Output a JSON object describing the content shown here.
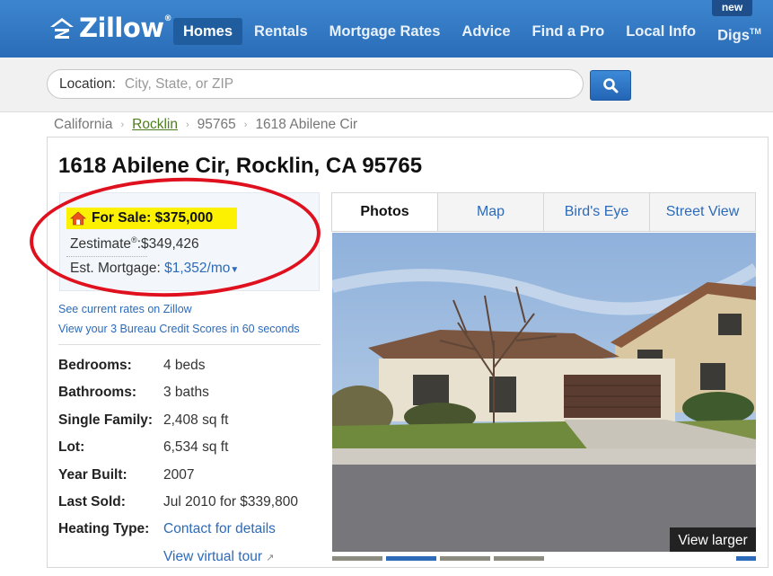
{
  "header": {
    "logo_text": "Zillow",
    "logo_reg": "®",
    "nav": [
      {
        "label": "Homes",
        "active": true
      },
      {
        "label": "Rentals",
        "active": false
      },
      {
        "label": "Mortgage Rates",
        "active": false
      },
      {
        "label": "Advice",
        "active": false
      },
      {
        "label": "Find a Pro",
        "active": false
      },
      {
        "label": "Local Info",
        "active": false
      },
      {
        "label": "Digs",
        "active": false,
        "superscript": "TM"
      }
    ],
    "new_badge": "new"
  },
  "search": {
    "label": "Location:",
    "placeholder": "City, State, or ZIP",
    "button_icon": "search-icon"
  },
  "breadcrumb": {
    "items": [
      "California",
      "Rocklin",
      "95765",
      "1618 Abilene Cir"
    ],
    "separator": "›"
  },
  "listing": {
    "address": "1618 Abilene Cir, Rocklin, CA 95765",
    "for_sale_label": "For Sale: $375,000",
    "zestimate_label": "Zestimate",
    "zestimate_reg": "®",
    "zestimate_value": ":$349,426",
    "mortgage_label": "Est. Mortgage:",
    "mortgage_value": "$1,352/mo",
    "rates_link": "See current rates on Zillow",
    "credit_link": "View your 3 Bureau Credit Scores in 60 seconds",
    "facts": [
      {
        "label": "Bedrooms:",
        "value": "4 beds"
      },
      {
        "label": "Bathrooms:",
        "value": "3 baths"
      },
      {
        "label": "Single Family:",
        "value": "2,408 sq ft"
      },
      {
        "label": "Lot:",
        "value": "6,534 sq ft"
      },
      {
        "label": "Year Built:",
        "value": "2007"
      },
      {
        "label": "Last Sold:",
        "value": "Jul 2010 for $339,800"
      },
      {
        "label": "Heating Type:",
        "value": "Contact for details"
      }
    ],
    "virtual_tour_link": "View virtual tour"
  },
  "media": {
    "tabs": [
      {
        "label": "Photos",
        "active": true
      },
      {
        "label": "Map",
        "active": false
      },
      {
        "label": "Bird's Eye",
        "active": false
      },
      {
        "label": "Street View",
        "active": false
      }
    ],
    "view_larger": "View larger"
  },
  "colors": {
    "brand_blue": "#2a6cb7",
    "link_blue": "#2d6ab8",
    "highlight_yellow": "#fbf100",
    "annotation_red": "#e0111e"
  }
}
